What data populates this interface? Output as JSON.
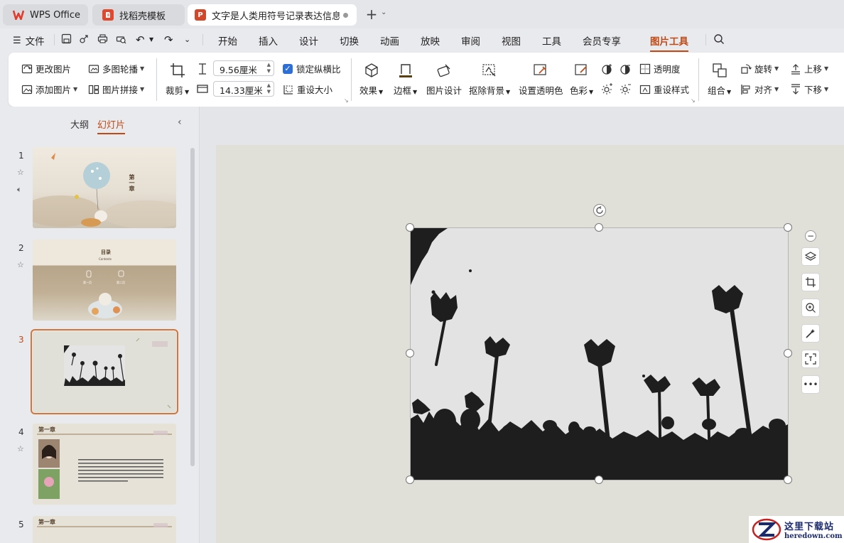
{
  "tabs": [
    {
      "label": "WPS Office",
      "icon": "wps-logo-icon",
      "color": "#e23b2e"
    },
    {
      "label": "找稻壳模板",
      "icon": "docer-icon",
      "color": "#e0492e"
    },
    {
      "label": "文字是人类用符号记录表达信息以",
      "icon": "ppt-file-icon",
      "color": "#d2462a"
    }
  ],
  "new_tab": "+",
  "menu": {
    "file": "文件",
    "items": [
      "开始",
      "插入",
      "设计",
      "切换",
      "动画",
      "放映",
      "审阅",
      "视图",
      "工具",
      "会员专享",
      "图片工具"
    ],
    "active": "图片工具"
  },
  "ribbon": {
    "change_picture": "更改图片",
    "add_picture": "添加图片",
    "multi_carousel": "多图轮播",
    "picture_stitch": "图片拼接",
    "crop": "裁剪",
    "height_value": "9.56厘米",
    "width_value": "14.33厘米",
    "lock_ratio": "锁定纵横比",
    "lock_ratio_checked": true,
    "reset_size": "重设大小",
    "effects": "效果",
    "border": "边框",
    "picture_design": "图片设计",
    "remove_background": "抠除背景",
    "set_transparent_color": "设置透明色",
    "color": "色彩",
    "transparency": "透明度",
    "reset_style": "重设样式",
    "group": "组合",
    "rotate": "旋转",
    "align": "对齐",
    "move_up": "上移",
    "move_down": "下移"
  },
  "left_pane": {
    "outline_tab": "大纲",
    "slides_tab": "幻灯片",
    "active_tab": "幻灯片",
    "slides": [
      {
        "number": "1",
        "icons": [
          "star-icon",
          "audio-icon"
        ],
        "texts": [
          "第一章"
        ]
      },
      {
        "number": "2",
        "icons": [
          "star-icon"
        ],
        "texts": [
          "目录",
          "Contents",
          "第一页",
          "第二页"
        ]
      },
      {
        "number": "3",
        "icons": [],
        "texts": [],
        "selected": true
      },
      {
        "number": "4",
        "icons": [
          "star-icon"
        ],
        "texts": [
          "第一章"
        ]
      },
      {
        "number": "5",
        "icons": [],
        "texts": [
          "第一章"
        ]
      }
    ]
  },
  "watermark": {
    "title": "这里下载站",
    "domain": "heredown.com"
  },
  "colors": {
    "accent": "#c04a16",
    "checkbox": "#2d6fd6",
    "selection_border": "#d2763a"
  }
}
